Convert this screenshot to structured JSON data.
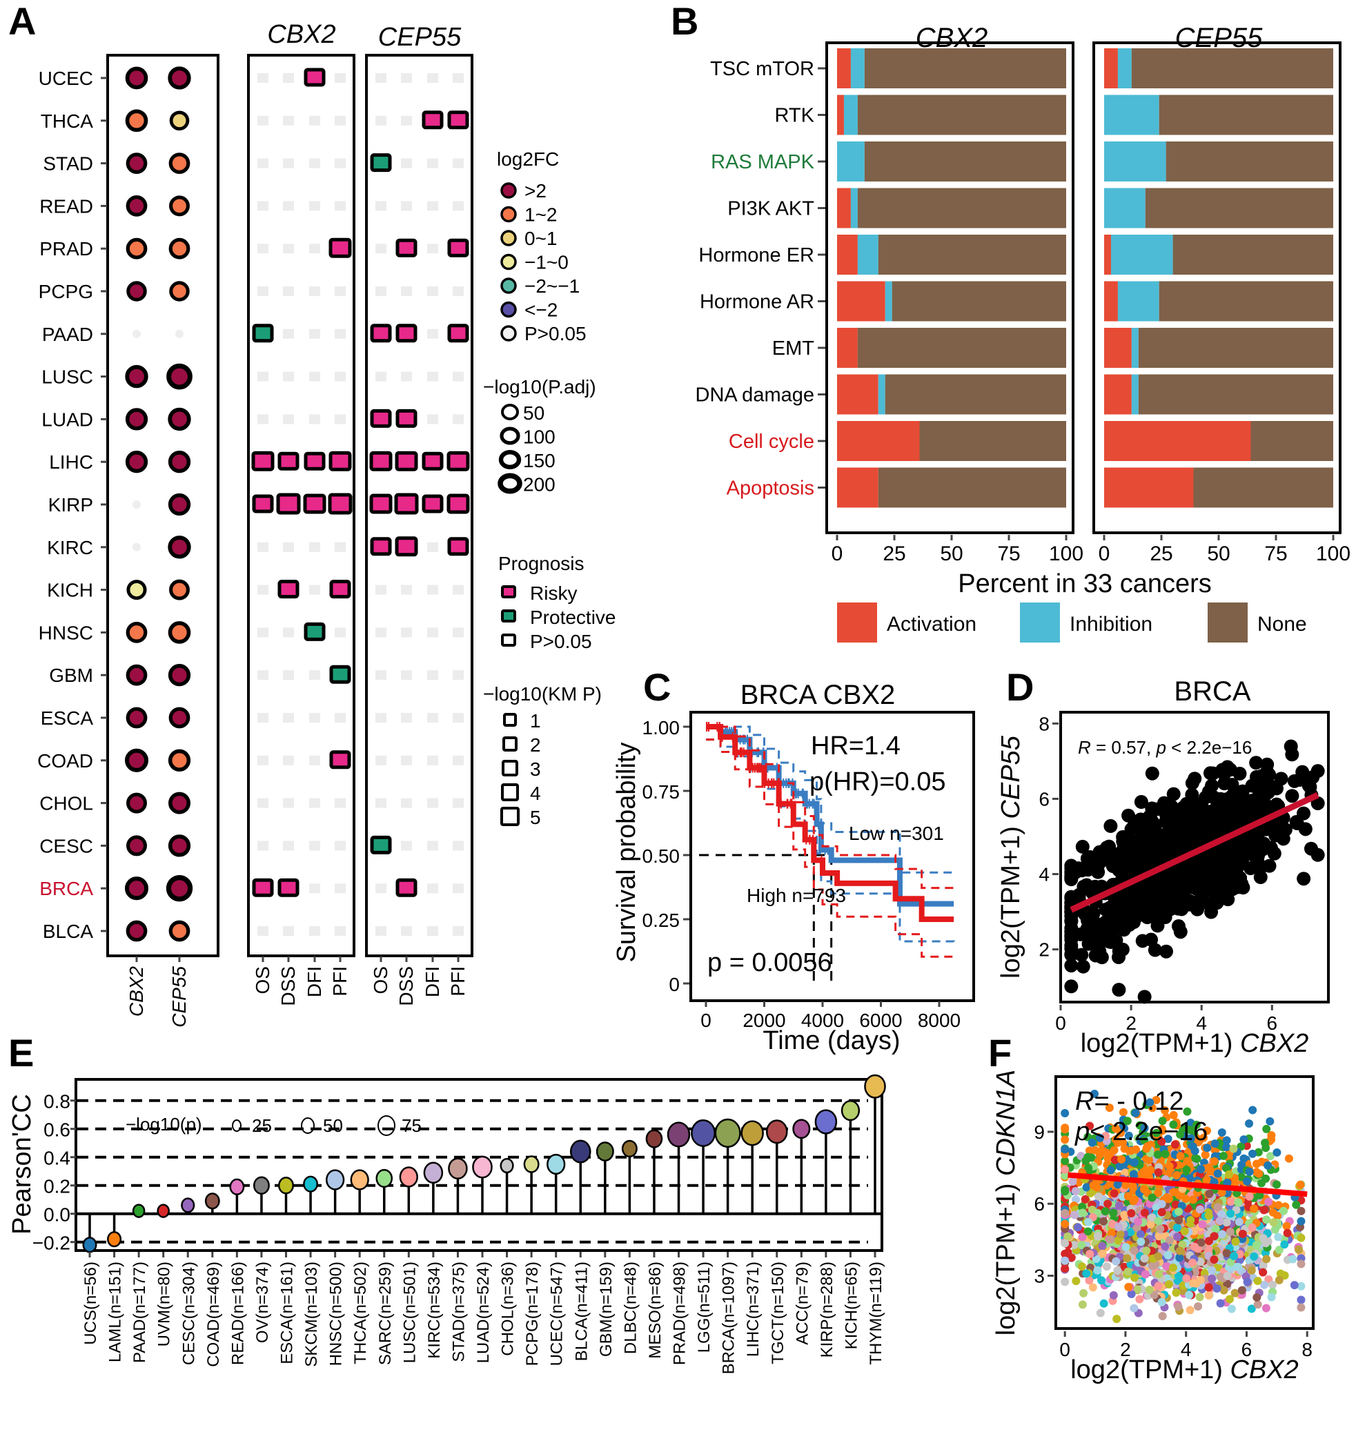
{
  "panels": {
    "A": "A",
    "B": "B",
    "C": "C",
    "D": "D",
    "E": "E",
    "F": "F"
  },
  "chart_data": [
    {
      "panel": "A",
      "type": "heatmap",
      "subtype": "dot-matrix",
      "cancers": [
        "UCEC",
        "THCA",
        "STAD",
        "READ",
        "PRAD",
        "PCPG",
        "PAAD",
        "LUSC",
        "LUAD",
        "LIHC",
        "KIRP",
        "KIRC",
        "KICH",
        "HNSC",
        "GBM",
        "ESCA",
        "COAD",
        "CHOL",
        "CESC",
        "BRCA",
        "BLCA"
      ],
      "highlight_cancer": "BRCA",
      "highlight_color": "#c8102e",
      "genes": [
        "CBX2",
        "CEP55"
      ],
      "expression": {
        "CBX2": [
          {
            "fc": ">2",
            "size": 100
          },
          {
            "fc": "1~2",
            "size": 100
          },
          {
            "fc": ">2",
            "size": 75
          },
          {
            "fc": ">2",
            "size": 75
          },
          {
            "fc": "1~2",
            "size": 75
          },
          {
            "fc": ">2",
            "size": 60
          },
          {
            "fc": "P>0.05",
            "size": 0
          },
          {
            "fc": ">2",
            "size": 110
          },
          {
            "fc": ">2",
            "size": 95
          },
          {
            "fc": ">2",
            "size": 95
          },
          {
            "fc": "P>0.05",
            "size": 0
          },
          {
            "fc": "P>0.05",
            "size": 0
          },
          {
            "fc": "-1~0",
            "size": 55
          },
          {
            "fc": "1~2",
            "size": 75
          },
          {
            "fc": ">2",
            "size": 75
          },
          {
            "fc": ">2",
            "size": 75
          },
          {
            "fc": ">2",
            "size": 120
          },
          {
            "fc": ">2",
            "size": 65
          },
          {
            "fc": ">2",
            "size": 65
          },
          {
            "fc": ">2",
            "size": 120
          },
          {
            "fc": ">2",
            "size": 75
          }
        ],
        "CEP55": [
          {
            "fc": ">2",
            "size": 110
          },
          {
            "fc": "0~1",
            "size": 50
          },
          {
            "fc": "1~2",
            "size": 75
          },
          {
            "fc": "1~2",
            "size": 65
          },
          {
            "fc": "1~2",
            "size": 75
          },
          {
            "fc": "1~2",
            "size": 60
          },
          {
            "fc": "P>0.05",
            "size": 0
          },
          {
            "fc": ">2",
            "size": 180
          },
          {
            "fc": ">2",
            "size": 110
          },
          {
            "fc": ">2",
            "size": 95
          },
          {
            "fc": ">2",
            "size": 95
          },
          {
            "fc": ">2",
            "size": 110
          },
          {
            "fc": "1~2",
            "size": 65
          },
          {
            "fc": "1~2",
            "size": 100
          },
          {
            "fc": ">2",
            "size": 95
          },
          {
            "fc": ">2",
            "size": 75
          },
          {
            "fc": "1~2",
            "size": 95
          },
          {
            "fc": ">2",
            "size": 90
          },
          {
            "fc": ">2",
            "size": 95
          },
          {
            "fc": ">2",
            "size": 190
          },
          {
            "fc": "1~2",
            "size": 75
          }
        ]
      },
      "survival_facets": [
        "CBX2",
        "CEP55"
      ],
      "survival_metrics": [
        "OS",
        "DSS",
        "DFI",
        "PFI"
      ],
      "prognosis": {
        "CBX2": [
          [
            "ns",
            "ns",
            "Risky:2",
            "ns"
          ],
          [
            "ns",
            "ns",
            "ns",
            "ns"
          ],
          [
            "ns",
            "ns",
            "ns",
            "ns"
          ],
          [
            "ns",
            "ns",
            "ns",
            "ns"
          ],
          [
            "ns",
            "ns",
            "ns",
            "Risky:3"
          ],
          [
            "ns",
            "ns",
            "ns",
            "ns"
          ],
          [
            "Protective:2",
            "ns",
            "ns",
            "ns"
          ],
          [
            "ns",
            "ns",
            "ns",
            "ns"
          ],
          [
            "ns",
            "ns",
            "ns",
            "ns"
          ],
          [
            "Risky:3",
            "Risky:2",
            "Risky:2",
            "Risky:3"
          ],
          [
            "Risky:2",
            "Risky:4",
            "Risky:3",
            "Risky:4"
          ],
          [
            "ns",
            "ns",
            "ns",
            "ns"
          ],
          [
            "ns",
            "Risky:2",
            "ns",
            "Risky:2"
          ],
          [
            "ns",
            "ns",
            "Protective:2",
            "ns"
          ],
          [
            "ns",
            "ns",
            "ns",
            "Protective:2"
          ],
          [
            "ns",
            "ns",
            "ns",
            "ns"
          ],
          [
            "ns",
            "ns",
            "ns",
            "Risky:2"
          ],
          [
            "ns",
            "ns",
            "ns",
            "ns"
          ],
          [
            "ns",
            "ns",
            "ns",
            "ns"
          ],
          [
            "Risky:2",
            "Risky:2",
            "ns",
            "ns"
          ],
          [
            "ns",
            "ns",
            "ns",
            "ns"
          ]
        ],
        "CEP55": [
          [
            "ns",
            "ns",
            "ns",
            "ns"
          ],
          [
            "ns",
            "ns",
            "Risky:2",
            "Risky:2"
          ],
          [
            "Protective:2",
            "ns",
            "ns",
            "ns"
          ],
          [
            "ns",
            "ns",
            "ns",
            "ns"
          ],
          [
            "ns",
            "Risky:2",
            "ns",
            "Risky:2"
          ],
          [
            "ns",
            "ns",
            "ns",
            "ns"
          ],
          [
            "Risky:2",
            "Risky:2",
            "ns",
            "Risky:2"
          ],
          [
            "ns",
            "ns",
            "ns",
            "ns"
          ],
          [
            "Risky:2",
            "Risky:2",
            "ns",
            "ns"
          ],
          [
            "Risky:3",
            "Risky:3",
            "Risky:2",
            "Risky:3"
          ],
          [
            "Risky:3",
            "Risky:4",
            "Risky:2",
            "Risky:3"
          ],
          [
            "Risky:2",
            "Risky:3",
            "ns",
            "Risky:2"
          ],
          [
            "ns",
            "ns",
            "ns",
            "ns"
          ],
          [
            "ns",
            "ns",
            "ns",
            "ns"
          ],
          [
            "ns",
            "ns",
            "ns",
            "ns"
          ],
          [
            "ns",
            "ns",
            "ns",
            "ns"
          ],
          [
            "ns",
            "ns",
            "ns",
            "ns"
          ],
          [
            "ns",
            "ns",
            "ns",
            "ns"
          ],
          [
            "Protective:2",
            "ns",
            "ns",
            "ns"
          ],
          [
            "ns",
            "Risky:2",
            "ns",
            "ns"
          ],
          [
            "ns",
            "ns",
            "ns",
            "ns"
          ]
        ]
      },
      "legend": {
        "log2fc_title": "log2FC",
        "log2fc_items": [
          {
            "label": ">2",
            "color": "#9b0e43"
          },
          {
            "label": "1~2",
            "color": "#f3774a"
          },
          {
            "label": "0~1",
            "color": "#ecd27c"
          },
          {
            "label": "−1~0",
            "color": "#eeeb9e"
          },
          {
            "label": "−2~−1",
            "color": "#57b8a5"
          },
          {
            "label": "<−2",
            "color": "#5a4fa6"
          },
          {
            "label": "P>0.05",
            "color": "#ffffff"
          }
        ],
        "padj_title": "−log10(P.adj)",
        "padj_items": [
          "50",
          "100",
          "150",
          "200"
        ],
        "prognosis_title": "Prognosis",
        "prognosis_items": [
          {
            "label": "Risky",
            "color": "#e7298a"
          },
          {
            "label": "Protective",
            "color": "#1b9e77"
          },
          {
            "label": "P>0.05",
            "color": "#ffffff"
          }
        ],
        "km_title": "−log10(KM P)",
        "km_items": [
          "1",
          "2",
          "3",
          "4",
          "5"
        ]
      }
    },
    {
      "panel": "B",
      "type": "bar",
      "subtype": "stacked-horizontal",
      "facets": [
        "CBX2",
        "CEP55"
      ],
      "categories": [
        "TSC mTOR",
        "RTK",
        "RAS MAPK",
        "PI3K AKT",
        "Hormone ER",
        "Hormone AR",
        "EMT",
        "DNA damage",
        "Cell cycle",
        "Apoptosis"
      ],
      "category_colors": {
        "RAS MAPK": "#1e7b3a",
        "Cell cycle": "#d7191c",
        "Apoptosis": "#d7191c"
      },
      "series_names": [
        "Activation",
        "Inhibition",
        "None"
      ],
      "series_colors": [
        "#e64b35",
        "#4dbbd5",
        "#7e6148"
      ],
      "values": {
        "CBX2": {
          "Activation": [
            6,
            3,
            0,
            6,
            9,
            21,
            9,
            18,
            36,
            18
          ],
          "Inhibition": [
            6,
            6,
            12,
            3,
            9,
            3,
            0,
            3,
            0,
            0
          ]
        },
        "CEP55": {
          "Activation": [
            6,
            0,
            0,
            0,
            3,
            6,
            12,
            12,
            64,
            39
          ],
          "Inhibition": [
            6,
            24,
            27,
            18,
            27,
            18,
            3,
            3,
            0,
            0
          ]
        }
      },
      "xlabel": "Percent in 33 cancers",
      "xticks": [
        "0",
        "25",
        "50",
        "75",
        "100"
      ],
      "xlim": [
        0,
        100
      ],
      "legend_position": "bottom"
    },
    {
      "panel": "C",
      "type": "line",
      "subtype": "kaplan-meier",
      "title": "BRCA CBX2",
      "xlabel": "Time (days)",
      "ylabel": "Survival probability",
      "xticks": [
        "0",
        "2000",
        "4000",
        "6000",
        "8000"
      ],
      "yticks": [
        "0",
        "0.25",
        "0.50",
        "0.75",
        "1.00"
      ],
      "xlim": [
        0,
        8500
      ],
      "ylim": [
        0,
        1
      ],
      "annotations": {
        "hr": "HR=1.4",
        "p_hr": "p(HR)=0.05",
        "low": "Low n=301",
        "high": "High n=793",
        "p": "p = 0.0056"
      },
      "series": [
        {
          "name": "Low",
          "color": "#3a7dc2",
          "x": [
            0,
            500,
            1000,
            1500,
            2000,
            2500,
            3000,
            3400,
            3800,
            3950,
            4300,
            6500,
            6650,
            8500
          ],
          "y": [
            1.0,
            0.98,
            0.95,
            0.9,
            0.84,
            0.78,
            0.74,
            0.7,
            0.62,
            0.52,
            0.48,
            0.48,
            0.31,
            0.31
          ]
        },
        {
          "name": "High",
          "color": "#e41a1c",
          "x": [
            0,
            500,
            1000,
            1500,
            2000,
            2500,
            3000,
            3400,
            3700,
            4000,
            4500,
            6500,
            7400,
            8500
          ],
          "y": [
            1.0,
            0.96,
            0.9,
            0.84,
            0.78,
            0.7,
            0.62,
            0.56,
            0.48,
            0.43,
            0.39,
            0.33,
            0.25,
            0.25
          ]
        }
      ],
      "median": {
        "High": 3700,
        "Low": 4300
      }
    },
    {
      "panel": "D",
      "type": "scatter",
      "title": "BRCA",
      "annotation": {
        "r_label": "R",
        "r_text": " = 0.57, ",
        "p_label": "p",
        "p_text": " < 2.2e−16"
      },
      "xlabel_prefix": "log2(TPM+1) ",
      "xlabel_gene": "CBX2",
      "ylabel_prefix": "log2(TPM+1) ",
      "ylabel_gene": "CEP55",
      "xticks": [
        "0",
        "2",
        "4",
        "6"
      ],
      "yticks": [
        "2",
        "4",
        "6",
        "8"
      ],
      "xlim": [
        0,
        7.6
      ],
      "ylim": [
        0.6,
        8.3
      ],
      "fit": {
        "x": [
          0.3,
          7.3
        ],
        "y": [
          3.05,
          6.1
        ],
        "color": "#c8102e"
      },
      "point_color": "#000000",
      "n_points": 1097
    },
    {
      "panel": "E",
      "type": "scatter",
      "subtype": "lollipop",
      "ylabel": "Pearson'CC",
      "yticks": [
        "−0.2",
        "0.0",
        "0.2",
        "0.4",
        "0.6",
        "0.8"
      ],
      "ylim": [
        -0.26,
        0.95
      ],
      "size_legend": {
        "title": "−log10(p)",
        "items": [
          "25",
          "50",
          "75"
        ]
      },
      "categories": [
        "UCS(n=56)",
        "LAML(n=151)",
        "PAAD(n=177)",
        "UVM(n=80)",
        "CESC(n=304)",
        "COAD(n=469)",
        "READ(n=166)",
        "OV(n=374)",
        "ESCA(n=161)",
        "SKCM(n=103)",
        "HNSC(n=500)",
        "THCA(n=502)",
        "SARC(n=259)",
        "LUSC(n=501)",
        "KIRC(n=534)",
        "STAD(n=375)",
        "LUAD(n=524)",
        "CHOL(n=36)",
        "PCPG(n=178)",
        "UCEC(n=547)",
        "BLCA(n=411)",
        "GBM(n=159)",
        "DLBC(n=48)",
        "MESO(n=86)",
        "PRAD(n=498)",
        "LGG(n=511)",
        "BRCA(n=1097)",
        "LIHC(n=371)",
        "TGCT(n=150)",
        "ACC(n=79)",
        "KIRP(n=288)",
        "KICH(n=65)",
        "THYM(n=119)"
      ],
      "values": [
        -0.22,
        -0.18,
        0.02,
        0.02,
        0.06,
        0.09,
        0.19,
        0.2,
        0.2,
        0.21,
        0.24,
        0.24,
        0.25,
        0.26,
        0.29,
        0.32,
        0.33,
        0.34,
        0.35,
        0.35,
        0.44,
        0.44,
        0.46,
        0.53,
        0.56,
        0.57,
        0.57,
        0.57,
        0.58,
        0.6,
        0.65,
        0.73,
        0.9
      ],
      "neglog10p": [
        10,
        10,
        5,
        5,
        8,
        12,
        12,
        18,
        15,
        12,
        30,
        30,
        20,
        30,
        35,
        35,
        40,
        8,
        15,
        30,
        45,
        25,
        15,
        20,
        60,
        75,
        90,
        60,
        50,
        25,
        55,
        30,
        50
      ],
      "colors": [
        "#1f77b4",
        "#ff7f0e",
        "#2ca02c",
        "#d62728",
        "#9467bd",
        "#8c564b",
        "#e377c2",
        "#7f7f7f",
        "#bcbd22",
        "#17becf",
        "#aec7e8",
        "#ffbb78",
        "#98df8a",
        "#ff9896",
        "#c5b0d5",
        "#c49c94",
        "#f7b6d2",
        "#c7c7c7",
        "#dbdb8d",
        "#9edae5",
        "#393b79",
        "#637939",
        "#8c6d31",
        "#843c39",
        "#7b4173",
        "#5254a3",
        "#8ca252",
        "#bd9e39",
        "#ad494a",
        "#a55194",
        "#6b6ecf",
        "#b5cf6b",
        "#e7ba52"
      ]
    },
    {
      "panel": "F",
      "type": "scatter",
      "annotation": {
        "r_label": "R",
        "r_text": "= - 0.12",
        "p_label": "p",
        "p_text": "< 2.2e−16"
      },
      "xlabel_prefix": "log2(TPM+1) ",
      "xlabel_gene": "CBX2",
      "ylabel_prefix": "log2(TPM+1) ",
      "ylabel_gene": "CDKN1A",
      "xticks": [
        "0",
        "2",
        "4",
        "6",
        "8"
      ],
      "yticks": [
        "3",
        "6",
        "9"
      ],
      "xlim": [
        -0.3,
        8.2
      ],
      "ylim": [
        0.8,
        11.3
      ],
      "fit": {
        "x": [
          0.1,
          8.0
        ],
        "y": [
          7.2,
          6.4
        ],
        "color": "#ff0000"
      },
      "point_palette": [
        "#ff7f0e",
        "#2ca02c",
        "#1f77b4",
        "#d62728",
        "#98df8a",
        "#c5b0d5",
        "#ff9896",
        "#9edae5",
        "#bcbd22",
        "#8c564b",
        "#17becf",
        "#c7c7c7",
        "#ffbb78",
        "#e377c2",
        "#6b6ecf",
        "#b5cf6b",
        "#bd9e39",
        "#aec7e8",
        "#c49c94",
        "#9467bd"
      ]
    }
  ]
}
